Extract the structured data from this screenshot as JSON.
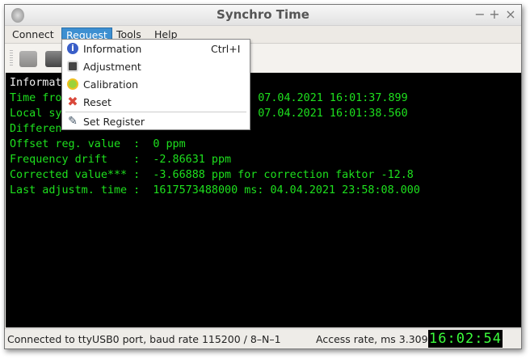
{
  "window": {
    "title": "Synchro Time",
    "controls": [
      "minimize",
      "maximize",
      "close"
    ]
  },
  "menubar": {
    "items": [
      "Connect",
      "Request",
      "Tools",
      "Help"
    ],
    "active": "Request"
  },
  "request_menu": {
    "items": [
      {
        "label": "Information",
        "shortcut": "Ctrl+I",
        "icon": "info-icon"
      },
      {
        "label": "Adjustment",
        "shortcut": "",
        "icon": "gauge-icon"
      },
      {
        "label": "Calibration",
        "shortcut": "",
        "icon": "stopwatch-icon"
      },
      {
        "label": "Reset",
        "shortcut": "",
        "icon": "red-x-icon"
      },
      {
        "label": "Set Register",
        "shortcut": "",
        "icon": "notepad-pen-icon"
      }
    ]
  },
  "toolbar": {
    "icons": [
      "connect-plug-icon",
      "disconnect-plug-icon"
    ]
  },
  "terminal": {
    "lines": [
      {
        "left": "Informat",
        "right": ""
      },
      {
        "left": "Time fro",
        "right": "ms: 07.04.2021 16:01:37.899"
      },
      {
        "left": "Local sy",
        "right": "ms: 07.04.2021 16:01:38.560"
      },
      {
        "left": "Differen",
        "right": ""
      },
      {
        "left": "Offset reg. value  :  0 ppm",
        "right": ""
      },
      {
        "left": "Frequency drift    :  -2.86631 ppm",
        "right": ""
      },
      {
        "left": "Corrected value*** :  -3.66888 ppm for correction faktor -12.8",
        "right": ""
      },
      {
        "left": "Last adjustm. time :  1617573488000 ms: 04.04.2021 23:58:08.000",
        "right": ""
      }
    ],
    "colors": {
      "text": "#1ee01e",
      "header": "#f0f0f0",
      "background": "#000000"
    }
  },
  "status": {
    "connection": "Connected to ttyUSB0 port, baud rate 115200 / 8–N–1",
    "access_rate": "Access rate, ms 3.309",
    "clock": "16:02:54"
  }
}
